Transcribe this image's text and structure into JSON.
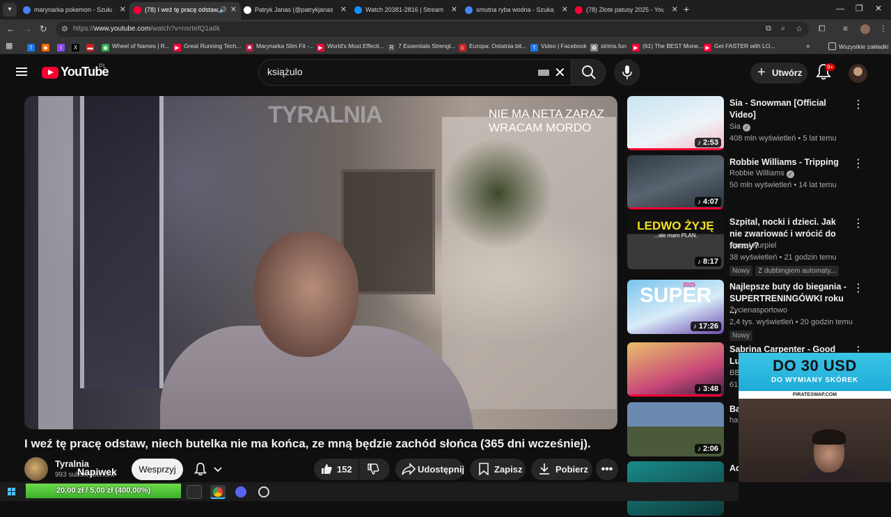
{
  "tabs": [
    {
      "title": "marynarka pokemon - Szukaj w",
      "active": false,
      "color": "#4285f4"
    },
    {
      "title": "(78) I weź tę pracę odstaw,",
      "active": true,
      "color": "#ff0033"
    },
    {
      "title": "Patryk Janas (@patrykjanasoffic",
      "active": false,
      "color": "#ffffff"
    },
    {
      "title": "Watch 20381-2816 | Streamable",
      "active": false,
      "color": "#0f90fa"
    },
    {
      "title": "smutna ryba wodna - Szukaj w",
      "active": false,
      "color": "#4285f4"
    },
    {
      "title": "(78) Złote patusy 2025 - YouTu",
      "active": false,
      "color": "#ff0033"
    }
  ],
  "url": {
    "prefix": "https://",
    "host": "www.youtube.com",
    "path": "/watch?v=nsrtefQ1a6k"
  },
  "bookmarks": [
    {
      "label": "",
      "color": "#1877f2",
      "glyph": "f"
    },
    {
      "label": "",
      "color": "#ff6a00",
      "glyph": "◆"
    },
    {
      "label": "",
      "color": "#9146ff",
      "glyph": "t"
    },
    {
      "label": "",
      "color": "#000000",
      "glyph": "X"
    },
    {
      "label": "",
      "color": "#cc2222",
      "glyph": "▬"
    },
    {
      "label": "Wheel of Names | R...",
      "color": "#34a853",
      "glyph": "◉"
    },
    {
      "label": "Great Running Tech...",
      "color": "#ff0033",
      "glyph": "▶"
    },
    {
      "label": "Marynarka Slim Fit -...",
      "color": "#aa2244",
      "glyph": "✱"
    },
    {
      "label": "World's Most Effecti...",
      "color": "#ff0033",
      "glyph": "▶"
    },
    {
      "label": "7 Essentials Strengt...",
      "color": "#444444",
      "glyph": "R"
    },
    {
      "label": "Europa: Ostatnia bit...",
      "color": "#cc2222",
      "glyph": "c"
    },
    {
      "label": "Video | Facebook",
      "color": "#1877f2",
      "glyph": "f"
    },
    {
      "label": "strims.fun",
      "color": "#888888",
      "glyph": "✿"
    },
    {
      "label": "(61) The BEST Mone...",
      "color": "#ff0033",
      "glyph": "▶"
    },
    {
      "label": "Get FASTER with LO...",
      "color": "#ff0033",
      "glyph": "▶"
    }
  ],
  "bookmarks_all": "Wszystkie zakładki",
  "masthead": {
    "logo": "YouTube",
    "country": "PL",
    "search_value": "książulo",
    "create": "Utwórz",
    "notif_count": "9+"
  },
  "player": {
    "watermark": "TYRALNIA",
    "overlay_line1": "NIE MA NETA ZARAZ",
    "overlay_line2": "WRACAM MORDO"
  },
  "video": {
    "title": "I weź tę pracę odstaw, niech butelka nie ma końca, ze mną będzie zachód słońca (365 dni wcześniej).",
    "channel": "Tyralnia",
    "subs": "993 subskrybentów",
    "napiwek": "Napiwek",
    "support": "Wesprzyj",
    "likes": "152",
    "share": "Udostępnij",
    "save": "Zapisz",
    "download": "Pobierz"
  },
  "sidebar": [
    {
      "title": "Sia - Snowman [Official Video]",
      "channel": "Sia",
      "meta": "408 mln wyświetleń • 5 lat temu",
      "duration": "2:53",
      "verified": true
    },
    {
      "title": "Robbie Williams - Tripping",
      "channel": "Robbie Williams",
      "meta": "50 mln wyświetleń • 14 lat temu",
      "duration": "4:07",
      "verified": true
    },
    {
      "title": "Szpital, nocki i dzieci. Jak nie zwariować i wrócić do formy?",
      "channel": "Paweł Kurpiel",
      "meta": "38 wyświetleń • 21 godzin temu",
      "duration": "8:17",
      "new": "Nowy",
      "dub": "Z dubbingiem automaty...",
      "thumb_text": "LEDWO ŻYJĘ",
      "thumb_sub": "...ale mam PLAN."
    },
    {
      "title": "Najlepsze buty do biegania - SUPERTRENINGÓWKI roku ...",
      "channel": "Życienasportowo",
      "meta": "2,4 tys. wyświetleń • 20 godzin temu",
      "duration": "17:26",
      "new": "Nowy",
      "thumb_text": "SUPER",
      "thumb_year": "2025"
    },
    {
      "title": "Sabrina Carpenter - Good Luck, Ba",
      "channel": "BBC",
      "meta": "61",
      "duration": "3:48"
    },
    {
      "title": "Ba Ha",
      "channel": "hap",
      "meta": "",
      "duration": "2:06"
    },
    {
      "title": "Ad Vi",
      "channel": "",
      "meta": "",
      "duration": ""
    }
  ],
  "promo": {
    "big": "DO 30 USD",
    "sub": "DO WYMIANY SKÓREK",
    "url": "PIRATESWAP.COM"
  },
  "taskbar": {
    "progress_text": "20,00 zł / 5,00 zł (400,00%)",
    "progress_fraction": 1.0
  }
}
